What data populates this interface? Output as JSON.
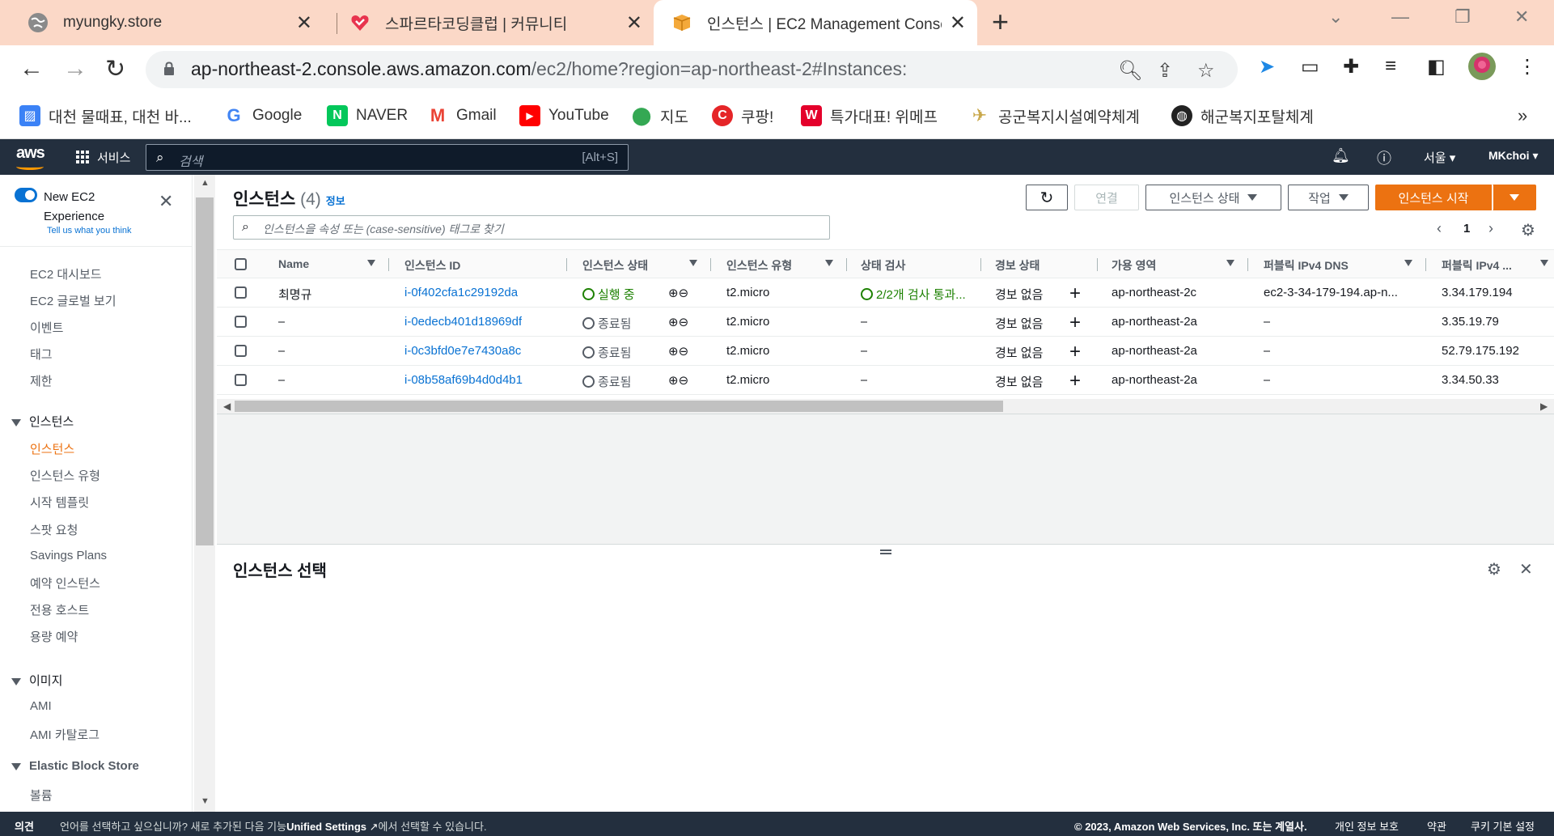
{
  "browser": {
    "tabs": [
      {
        "title": "myungky.store",
        "icon": "globe-icon"
      },
      {
        "title": "스파르타코딩클럽 | 커뮤니티",
        "icon": "sparta-icon"
      },
      {
        "title": "인스턴스 | EC2 Management Conso",
        "icon": "aws-box-icon",
        "active": true
      }
    ],
    "url_host": "ap-northeast-2.console.aws.amazon.com",
    "url_path": "/ec2/home?region=ap-northeast-2#Instances:",
    "bookmarks": [
      {
        "label": "대천 물때표, 대천 바...",
        "icon": "image-icon",
        "color": "#3b82f6"
      },
      {
        "label": "Google",
        "icon": "google-icon",
        "color": "#4285f4"
      },
      {
        "label": "NAVER",
        "icon": "naver-icon",
        "color": "#03c75a"
      },
      {
        "label": "Gmail",
        "icon": "gmail-icon",
        "color": "#ea4335"
      },
      {
        "label": "YouTube",
        "icon": "youtube-icon",
        "color": "#ff0000"
      },
      {
        "label": "지도",
        "icon": "maps-icon",
        "color": "#34a853"
      },
      {
        "label": "쿠팡!",
        "icon": "coupang-icon",
        "color": "#e52528"
      },
      {
        "label": "특가대표! 위메프",
        "icon": "wemakeprice-icon",
        "color": "#e4002b"
      },
      {
        "label": "공군복지시설예약체계",
        "icon": "airforce-icon",
        "color": "#c9a84b"
      },
      {
        "label": "해군복지포탈체계",
        "icon": "navy-icon",
        "color": "#222222"
      }
    ]
  },
  "aws": {
    "logo": "aws",
    "services_label": "서비스",
    "search_placeholder": "검색",
    "search_shortcut": "[Alt+S]",
    "region": "서울",
    "user": "MKchoi"
  },
  "sidebar": {
    "new_experience": "New EC2 Experience",
    "feedback": "Tell us what you think",
    "top_items": [
      "EC2 대시보드",
      "EC2 글로벌 보기",
      "이벤트",
      "태그",
      "제한"
    ],
    "sections": [
      {
        "title": "인스턴스",
        "items": [
          "인스턴스",
          "인스턴스 유형",
          "시작 템플릿",
          "스팟 요청",
          "Savings Plans",
          "예약 인스턴스",
          "전용 호스트",
          "용량 예약"
        ]
      },
      {
        "title": "이미지",
        "items": [
          "AMI",
          "AMI 카탈로그"
        ]
      },
      {
        "title": "Elastic Block Store",
        "items": [
          "볼륨"
        ]
      }
    ],
    "active_item": "인스턴스"
  },
  "instances": {
    "title": "인스턴스",
    "count": "(4)",
    "info": "정보",
    "buttons": {
      "connect": "연결",
      "state": "인스턴스 상태",
      "actions": "작업",
      "launch": "인스턴스 시작"
    },
    "filter_placeholder": "인스턴스을 속성 또는 (case-sensitive) 태그로 찾기",
    "page": "1",
    "columns": [
      "Name",
      "인스턴스 ID",
      "인스턴스 상태",
      "인스턴스 유형",
      "상태 검사",
      "경보 상태",
      "가용 영역",
      "퍼블릭 IPv4 DNS",
      "퍼블릭 IPv4 ..."
    ],
    "rows": [
      {
        "name": "최명규",
        "id": "i-0f402cfa1c29192da",
        "state": "실행 중",
        "state_kind": "running",
        "type": "t2.micro",
        "check": "2/2개 검사 통과...",
        "alarm": "경보 없음",
        "az": "ap-northeast-2c",
        "dns": "ec2-3-34-179-194.ap-n...",
        "ip": "3.34.179.194"
      },
      {
        "name": "–",
        "id": "i-0edecb401d18969df",
        "state": "종료됨",
        "state_kind": "terminated",
        "type": "t2.micro",
        "check": "–",
        "alarm": "경보 없음",
        "az": "ap-northeast-2a",
        "dns": "–",
        "ip": "3.35.19.79"
      },
      {
        "name": "–",
        "id": "i-0c3bfd0e7e7430a8c",
        "state": "종료됨",
        "state_kind": "terminated",
        "type": "t2.micro",
        "check": "–",
        "alarm": "경보 없음",
        "az": "ap-northeast-2a",
        "dns": "–",
        "ip": "52.79.175.192"
      },
      {
        "name": "–",
        "id": "i-08b58af69b4d0d4b1",
        "state": "종료됨",
        "state_kind": "terminated",
        "type": "t2.micro",
        "check": "–",
        "alarm": "경보 없음",
        "az": "ap-northeast-2a",
        "dns": "–",
        "ip": "3.34.50.33"
      }
    ]
  },
  "detail": {
    "title": "인스턴스 선택"
  },
  "footer": {
    "feedback": "의견",
    "language_prefix": "언어를 선택하고 싶으십니까? 새로 추가된 다음 기능",
    "language_link": "Unified Settings",
    "language_suffix": "에서 선택할 수 있습니다.",
    "copyright": "© 2023, Amazon Web Services, Inc. 또는 계열사.",
    "privacy": "개인 정보 보호",
    "terms": "약관",
    "cookies": "쿠키 기본 설정"
  },
  "colors": {
    "accent": "#ec7211",
    "link": "#0972d3",
    "nav": "#232f3e",
    "ok": "#1d8102",
    "tabbar": "#fbd8c7"
  }
}
